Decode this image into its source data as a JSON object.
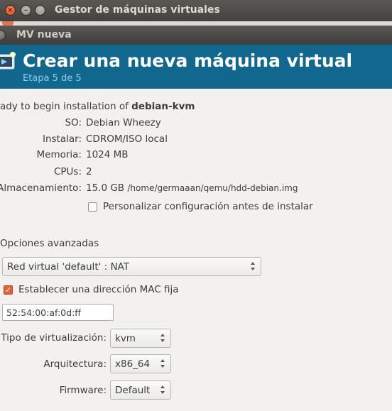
{
  "parent_window": {
    "title": "Gestor de máquinas virtuales"
  },
  "dialog": {
    "title": "MV nueva",
    "header_title": "Crear una nueva máquina virtual",
    "step": "Etapa 5 de 5"
  },
  "summary": {
    "ready_prefix": "ady to begin installation of ",
    "vm_name": "debian-kvm",
    "rows": [
      {
        "label": "SO:",
        "value": "Debian Wheezy"
      },
      {
        "label": "Instalar:",
        "value": "CDROM/ISO local"
      },
      {
        "label": "Memoria:",
        "value": "1024 MB"
      },
      {
        "label": "CPUs:",
        "value": "2"
      },
      {
        "label": "Almacenamiento:",
        "value": "15.0 GB",
        "path": "/home/germaaan/qemu/hdd-debian.img"
      }
    ],
    "customize_label": "Personalizar configuración antes de instalar",
    "customize_checked": false
  },
  "advanced": {
    "heading": "Opciones avanzadas",
    "network_select": "Red virtual 'default' : NAT",
    "mac_checkbox_label": "Establecer una dirección MAC fija",
    "mac_checked": true,
    "mac_value": "52:54:00:af:0d:ff",
    "virt_type_label": "Tipo de virtualización:",
    "virt_type_value": "kvm",
    "arch_label": "Arquitectura:",
    "arch_value": "x86_64",
    "firmware_label": "Firmware:",
    "firmware_value": "Default"
  },
  "colors": {
    "header_bg": "#12678f",
    "accent_orange": "#e5603a",
    "titlebar": "#43423e"
  }
}
